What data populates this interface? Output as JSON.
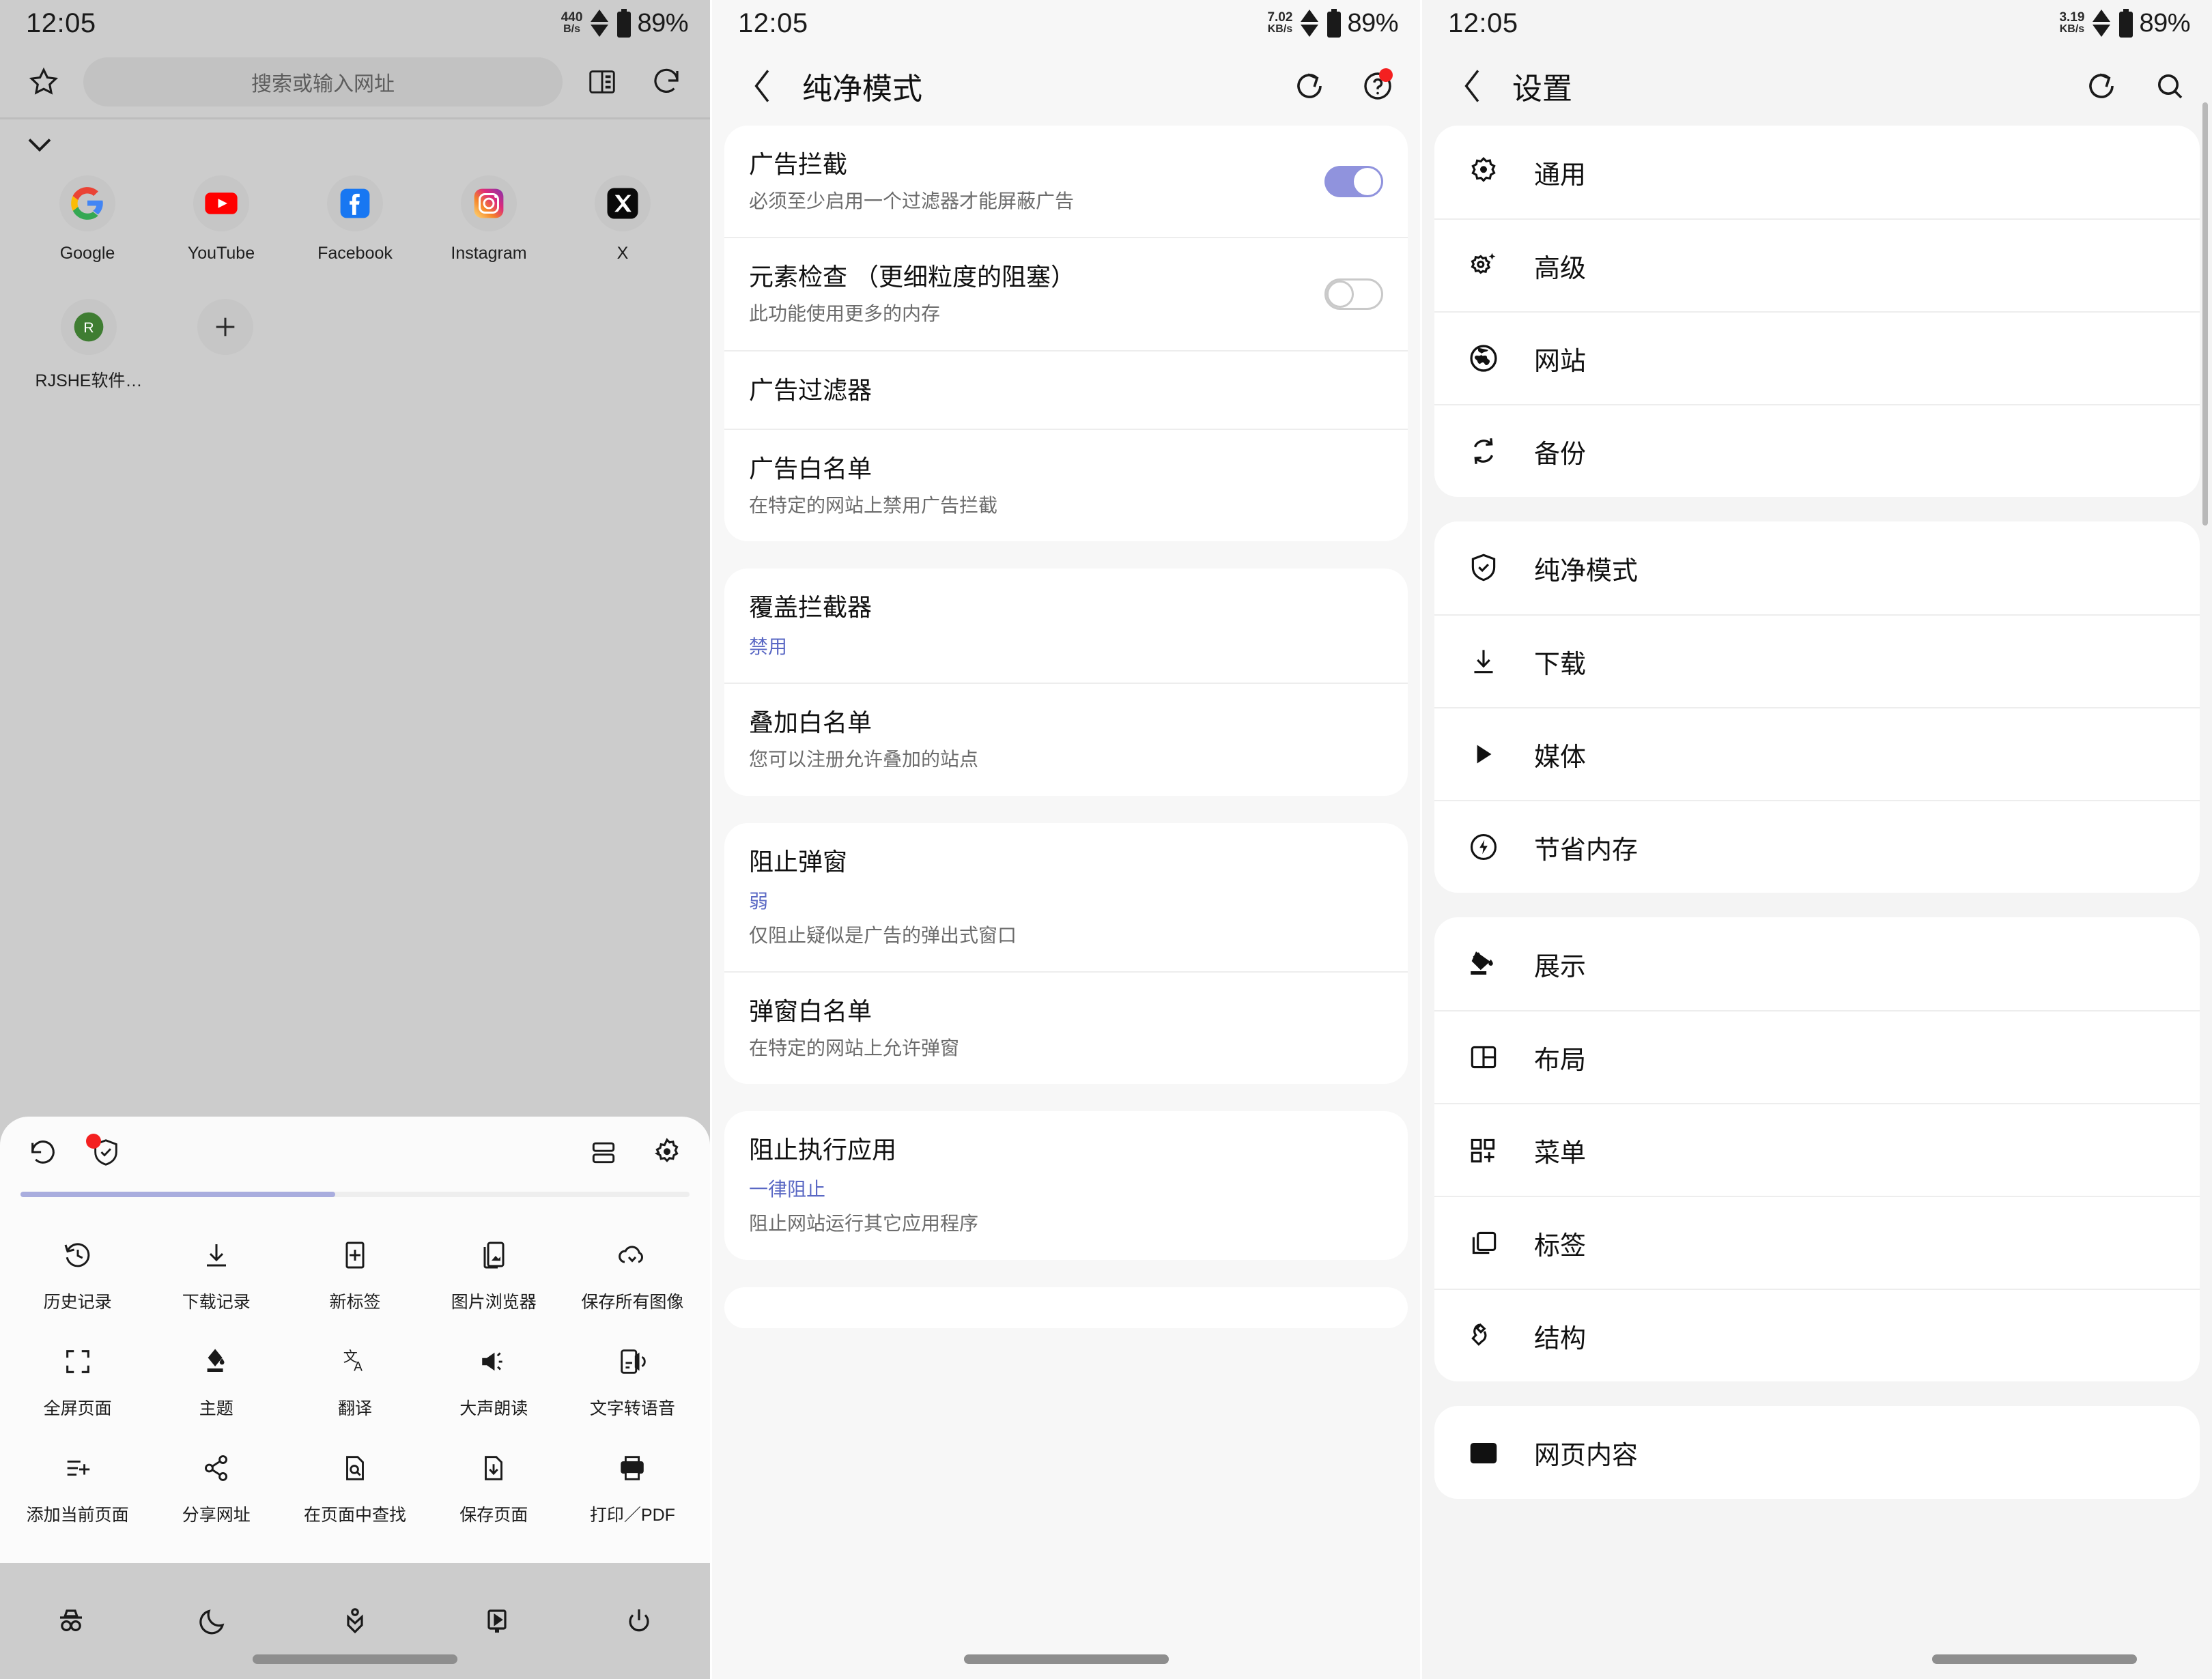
{
  "status_bars": [
    {
      "time": "12:05",
      "net_rate": "440",
      "net_unit": "B/s",
      "battery": "89%"
    },
    {
      "time": "12:05",
      "net_rate": "7.02",
      "net_unit": "KB/s",
      "battery": "89%"
    },
    {
      "time": "12:05",
      "net_rate": "3.19",
      "net_unit": "KB/s",
      "battery": "89%"
    }
  ],
  "browser": {
    "url_placeholder": "搜索或输入网址",
    "shortcuts": [
      {
        "label": "Google",
        "icon": "google-icon"
      },
      {
        "label": "YouTube",
        "icon": "youtube-icon"
      },
      {
        "label": "Facebook",
        "icon": "facebook-icon"
      },
      {
        "label": "Instagram",
        "icon": "instagram-icon"
      },
      {
        "label": "X",
        "icon": "x-icon"
      },
      {
        "label": "RJSHE软件…",
        "icon": "rjshe-icon"
      },
      {
        "label": "",
        "icon": "add-icon"
      }
    ],
    "menu_grid": [
      {
        "label": "历史记录",
        "icon": "history-icon"
      },
      {
        "label": "下载记录",
        "icon": "download-icon"
      },
      {
        "label": "新标签",
        "icon": "new-tab-icon"
      },
      {
        "label": "图片浏览器",
        "icon": "image-browser-icon"
      },
      {
        "label": "保存所有图像",
        "icon": "save-all-images-icon"
      },
      {
        "label": "全屏页面",
        "icon": "fullscreen-icon"
      },
      {
        "label": "主题",
        "icon": "theme-icon"
      },
      {
        "label": "翻译",
        "icon": "translate-icon"
      },
      {
        "label": "大声朗读",
        "icon": "read-aloud-icon"
      },
      {
        "label": "文字转语音",
        "icon": "text-to-speech-icon"
      },
      {
        "label": "添加当前页面",
        "icon": "add-current-page-icon"
      },
      {
        "label": "分享网址",
        "icon": "share-url-icon"
      },
      {
        "label": "在页面中查找",
        "icon": "find-in-page-icon"
      },
      {
        "label": "保存页面",
        "icon": "save-page-icon"
      },
      {
        "label": "打印／PDF",
        "icon": "print-pdf-icon"
      }
    ],
    "bottom_bar": [
      {
        "icon": "incognito-icon"
      },
      {
        "icon": "night-mode-icon"
      },
      {
        "icon": "bookmark-icon"
      },
      {
        "icon": "video-icon"
      },
      {
        "icon": "power-icon"
      }
    ],
    "progress_percent": 47
  },
  "pure_mode": {
    "title": "纯净模式",
    "groups": [
      {
        "rows": [
          {
            "title": "广告拦截",
            "subtitle": "必须至少启用一个过滤器才能屏蔽广告",
            "control": "toggle",
            "toggle_on": true
          },
          {
            "title": "元素检查 （更细粒度的阻塞）",
            "subtitle": "此功能使用更多的内存",
            "control": "toggle",
            "toggle_on": false
          },
          {
            "title": "广告过滤器",
            "subtitle": "",
            "control": "none"
          },
          {
            "title": "广告白名单",
            "subtitle": "在特定的网站上禁用广告拦截",
            "control": "none"
          }
        ]
      },
      {
        "rows": [
          {
            "title": "覆盖拦截器",
            "value": "禁用",
            "subtitle": "",
            "control": "none"
          },
          {
            "title": "叠加白名单",
            "subtitle": "您可以注册允许叠加的站点",
            "control": "none"
          }
        ]
      },
      {
        "rows": [
          {
            "title": "阻止弹窗",
            "value": "弱",
            "subtitle": "仅阻止疑似是广告的弹出式窗口",
            "control": "none"
          },
          {
            "title": "弹窗白名单",
            "subtitle": "在特定的网站上允许弹窗",
            "control": "none"
          }
        ]
      },
      {
        "rows": [
          {
            "title": "阻止执行应用",
            "value": "一律阻止",
            "subtitle": "阻止网站运行其它应用程序",
            "control": "none"
          }
        ]
      }
    ]
  },
  "settings": {
    "title": "设置",
    "groups": [
      {
        "items": [
          {
            "label": "通用",
            "icon": "gear-icon"
          },
          {
            "label": "高级",
            "icon": "gear-sparkle-icon"
          },
          {
            "label": "网站",
            "icon": "globe-icon"
          },
          {
            "label": "备份",
            "icon": "sync-icon"
          }
        ]
      },
      {
        "items": [
          {
            "label": "纯净模式",
            "icon": "shield-check-icon"
          },
          {
            "label": "下载",
            "icon": "download-icon"
          },
          {
            "label": "媒体",
            "icon": "play-icon"
          },
          {
            "label": "节省内存",
            "icon": "memory-save-icon"
          }
        ]
      },
      {
        "items": [
          {
            "label": "展示",
            "icon": "paint-icon"
          },
          {
            "label": "布局",
            "icon": "layout-icon"
          },
          {
            "label": "菜单",
            "icon": "menu-grid-icon"
          },
          {
            "label": "标签",
            "icon": "tabs-icon"
          },
          {
            "label": "结构",
            "icon": "wrench-icon"
          }
        ]
      },
      {
        "items": [
          {
            "label": "网页内容",
            "icon": "content-icon"
          }
        ]
      }
    ]
  },
  "colors": {
    "toggle_on": "#9093dd",
    "accent_link": "#5a68c4",
    "badge_red": "#f42020",
    "progress": "#a9adde"
  }
}
